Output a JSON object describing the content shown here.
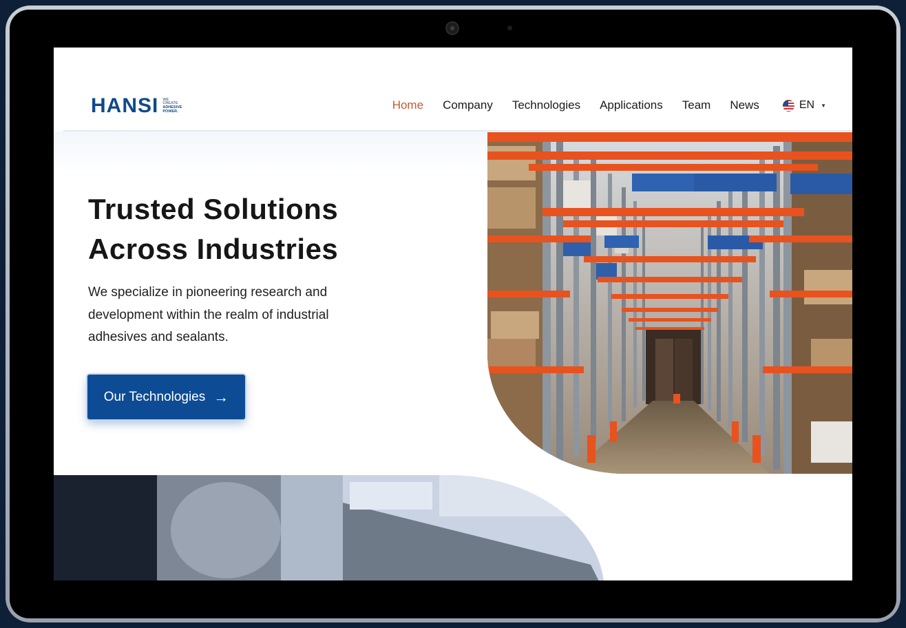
{
  "header": {
    "logo": {
      "word": "HANSI",
      "tagline_1": "WE",
      "tagline_2": "CREATE",
      "tagline_3": "ADHESIVE",
      "tagline_4": "POWER."
    },
    "nav": [
      {
        "label": "Home",
        "active": true
      },
      {
        "label": "Company",
        "active": false
      },
      {
        "label": "Technologies",
        "active": false
      },
      {
        "label": "Applications",
        "active": false
      },
      {
        "label": "Team",
        "active": false
      },
      {
        "label": "News",
        "active": false
      }
    ],
    "language": {
      "label": "EN",
      "flag_icon": "us-flag-icon"
    }
  },
  "hero": {
    "title_line_1": "Trusted Solutions",
    "title_line_2": "Across Industries",
    "text_line_1": "We specialize in pioneering research and",
    "text_line_2": "development within the realm of industrial",
    "text_line_3": "adhesives and sealants.",
    "cta_label": "Our Technologies",
    "cta_icon": "arrow-right-icon"
  },
  "colors": {
    "brand_blue": "#0d4c94",
    "accent_orange": "#c55a2e",
    "text_dark": "#161616"
  }
}
